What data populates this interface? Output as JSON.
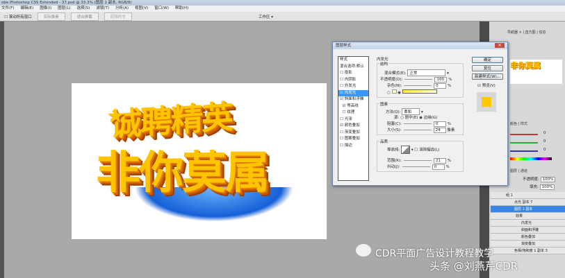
{
  "window": {
    "title": "obe Photoshop CS5 Extended - 37.psd @ 33.3% (图层 1 副本, RGB/8)"
  },
  "menu": [
    "文件(F)",
    "编辑(E)",
    "图像(I)",
    "图层(L)",
    "选择(S)",
    "滤镜(T)",
    "分析(A)",
    "视图(V)",
    "窗口(W)",
    "帮助(H)"
  ],
  "options": {
    "checkbox": "滚动所有窗口",
    "buttons": [
      "实际像素",
      "适合屏幕",
      "打印尺寸"
    ],
    "workspace": "工作区 ▾"
  },
  "canvas": {
    "line1": "诚聘精英",
    "line2": "非你莫属"
  },
  "dialog": {
    "title": "图层样式",
    "close": "✕",
    "styles": [
      "样式",
      "混合选项:默认",
      "投影",
      "内阴影",
      "外发光",
      "内发光",
      "斜面和浮雕",
      "等高线",
      "纹理",
      "光泽",
      "颜色叠加",
      "渐变叠加",
      "图案叠加",
      "描边"
    ],
    "section": "内发光",
    "structure": {
      "title": "结构",
      "blend_label": "混合模式(E):",
      "blend_value": "正常",
      "opacity_label": "不透明度(O):",
      "opacity": "100",
      "noise_label": "杂色(N):",
      "noise": "0",
      "pct": "%"
    },
    "elements": {
      "title": "图素",
      "method_label": "方法(Q):",
      "method_value": "柔和",
      "source_label": "源:",
      "center": "居中(E)",
      "edge": "边缘(G)",
      "choke_label": "阻塞(C):",
      "choke": "0",
      "size_label": "大小(S):",
      "size": "24",
      "px": "像素"
    },
    "quality": {
      "title": "品质",
      "contour_label": "等高线:",
      "antialias": "消除锯齿(L)",
      "range_label": "范围(R):",
      "range": "21",
      "jitter_label": "抖动(J):",
      "jitter": "0"
    },
    "buttons": {
      "ok": "确定",
      "reset": "复位",
      "new_style": "新建样式(W)...",
      "preview": "预览(V)"
    }
  },
  "panels": {
    "nav_tabs": [
      "导航器 ×",
      "直方图",
      "信息"
    ],
    "color_tabs": [
      "颜色",
      "样式"
    ],
    "rgb": [
      "0",
      "0",
      "0"
    ],
    "layers_tabs": [
      "图层",
      "通道"
    ],
    "opacity_label": "不透明度:",
    "opacity": "100%",
    "fill_label": "填充:",
    "fill": "100%",
    "layers": [
      "组 1",
      "点光 副本 7",
      "图层 1 副本",
      "效果",
      "内发光",
      "斜面和浮雕",
      "颜色叠加",
      "渐变叠加",
      "色相/饱和度 1 副本 3"
    ]
  },
  "watermark": {
    "line1": "CDR平面广告设计教程教学",
    "line2": "头条 @刘燕芹CDR"
  }
}
